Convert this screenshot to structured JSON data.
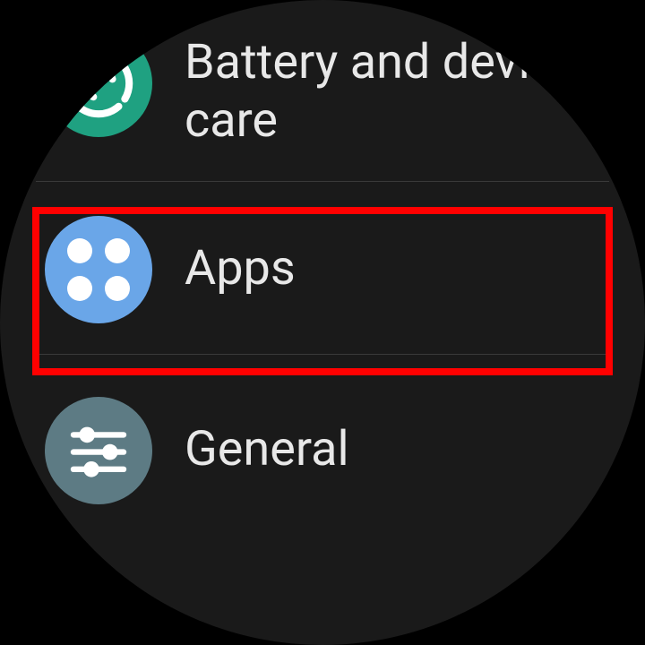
{
  "settings": {
    "items": [
      {
        "id": "battery-device-care",
        "label": "Battery and device care",
        "icon": "battery-care-icon",
        "icon_bg": "#1fa181"
      },
      {
        "id": "apps",
        "label": "Apps",
        "icon": "apps-icon",
        "icon_bg": "#6aa6e8",
        "highlighted": true
      },
      {
        "id": "general",
        "label": "General",
        "icon": "sliders-icon",
        "icon_bg": "#5d7b84"
      }
    ]
  },
  "highlight_color": "#ff0000"
}
